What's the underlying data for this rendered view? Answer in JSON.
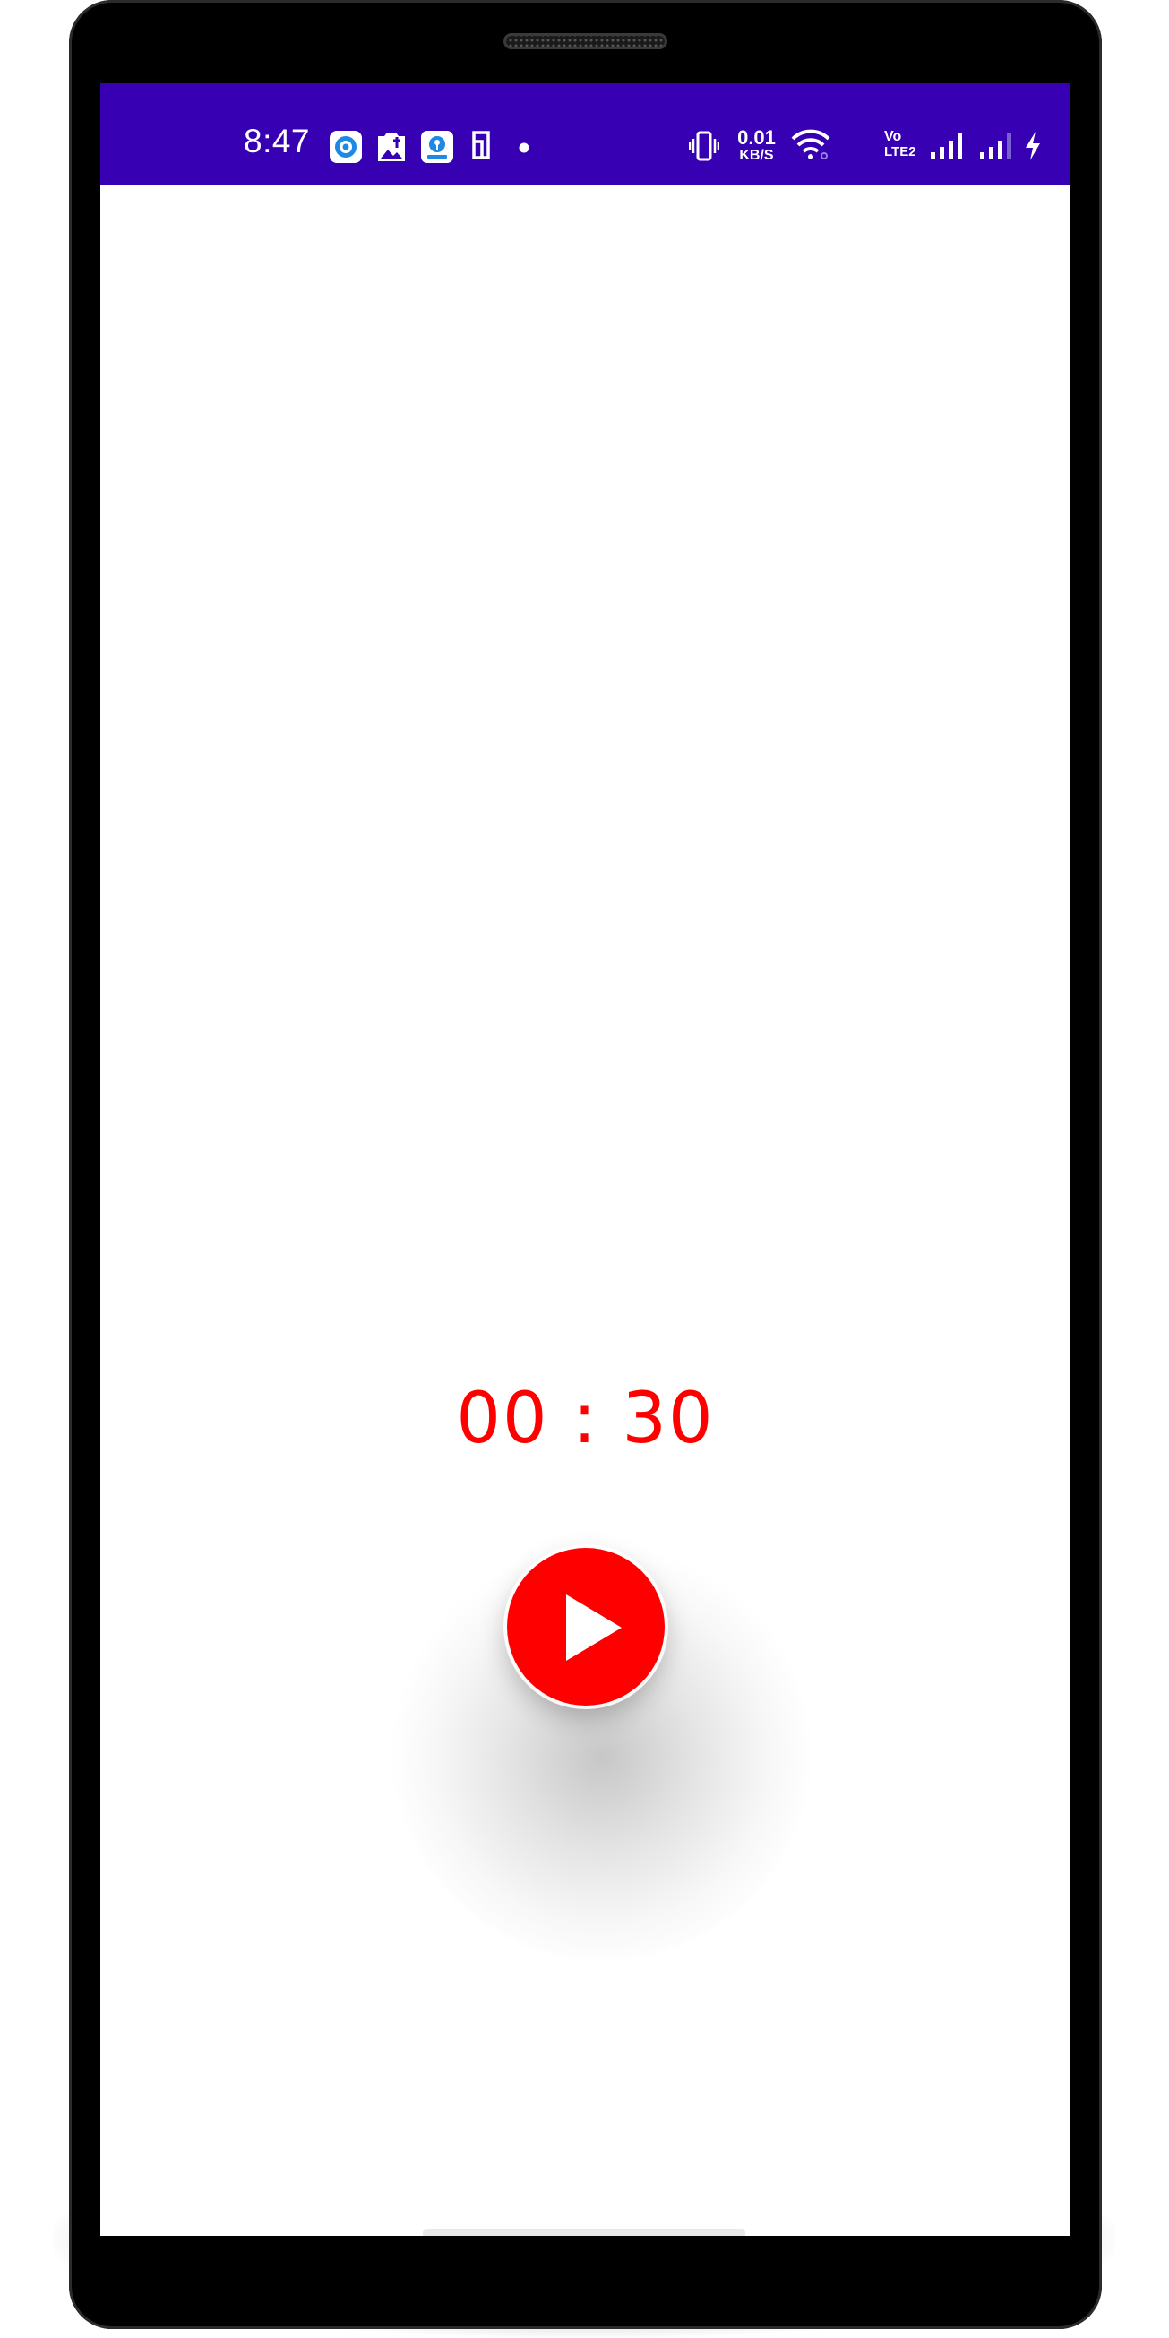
{
  "status_bar": {
    "time": "8:47",
    "background_color": "#3700b3",
    "notification_icons": [
      "target-app-icon",
      "photo-gallery-icon",
      "sbi-card-icon",
      "phone-outline-icon",
      "dot-icon"
    ],
    "network_speed_value": "0.01",
    "network_speed_unit": "KB/S",
    "volte_label_top": "Vo",
    "volte_label_bottom": "LTE2",
    "system_icons": [
      "vibrate-icon",
      "wifi-icon",
      "signal-icon",
      "signal-icon",
      "charging-icon"
    ]
  },
  "timer": {
    "display": "00 : 30",
    "color": "#ff0000"
  },
  "controls": {
    "play_button_icon": "play-icon",
    "play_button_color": "#ff0000"
  }
}
